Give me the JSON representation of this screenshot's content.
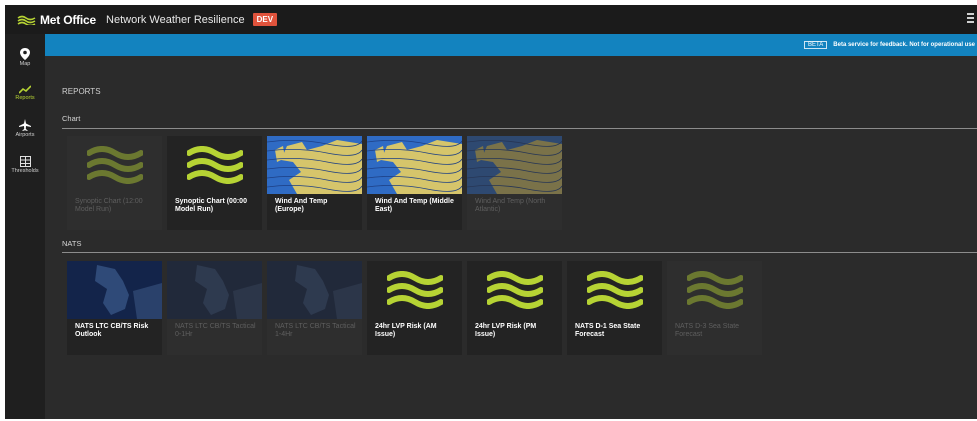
{
  "header": {
    "logo_text": "Met Office",
    "app_title": "Network Weather Resilience",
    "env_badge": "DEV"
  },
  "sidebar": {
    "items": [
      {
        "label": "Map",
        "icon": "map-pin-icon",
        "active": false
      },
      {
        "label": "Reports",
        "icon": "chart-icon",
        "active": true
      },
      {
        "label": "Airports",
        "icon": "airplane-icon",
        "active": false
      },
      {
        "label": "Thresholds",
        "icon": "thresholds-icon",
        "active": false
      }
    ]
  },
  "banner": {
    "badge": "BETA",
    "text": "Beta service for feedback. Not for operational use"
  },
  "page": {
    "title": "REPORTS"
  },
  "sections": {
    "chart": {
      "label": "Chart",
      "tiles": [
        {
          "label": "Synoptic Chart (12:00 Model Run)",
          "thumb": "waves",
          "enabled": false
        },
        {
          "label": "Synoptic Chart (00:00 Model Run)",
          "thumb": "waves",
          "enabled": true
        },
        {
          "label": "Wind And Temp (Europe)",
          "thumb": "map",
          "enabled": true
        },
        {
          "label": "Wind And Temp (Middle East)",
          "thumb": "map",
          "enabled": true
        },
        {
          "label": "Wind And Temp (North Atlantic)",
          "thumb": "map",
          "enabled": false
        }
      ]
    },
    "nats": {
      "label": "NATS",
      "tiles": [
        {
          "label": "NATS LTC CB/TS Risk Outlook",
          "thumb": "nats-map",
          "enabled": true
        },
        {
          "label": "NATS LTC CB/TS Tactical 0-1Hr",
          "thumb": "nats-map",
          "enabled": false
        },
        {
          "label": "NATS LTC CB/TS Tactical 1-4Hr",
          "thumb": "nats-map",
          "enabled": false
        },
        {
          "label": "24hr LVP Risk (AM Issue)",
          "thumb": "waves",
          "enabled": true
        },
        {
          "label": "24hr LVP Risk (PM Issue)",
          "thumb": "waves",
          "enabled": true
        },
        {
          "label": "NATS D-1 Sea State Forecast",
          "thumb": "waves",
          "enabled": true
        },
        {
          "label": "NATS D-3 Sea State Forecast",
          "thumb": "waves",
          "enabled": false
        }
      ]
    }
  },
  "colors": {
    "accent_green": "#b6d334",
    "banner_blue": "#1383bf",
    "dev_badge": "#e0533c",
    "background": "#2b2b2b"
  }
}
